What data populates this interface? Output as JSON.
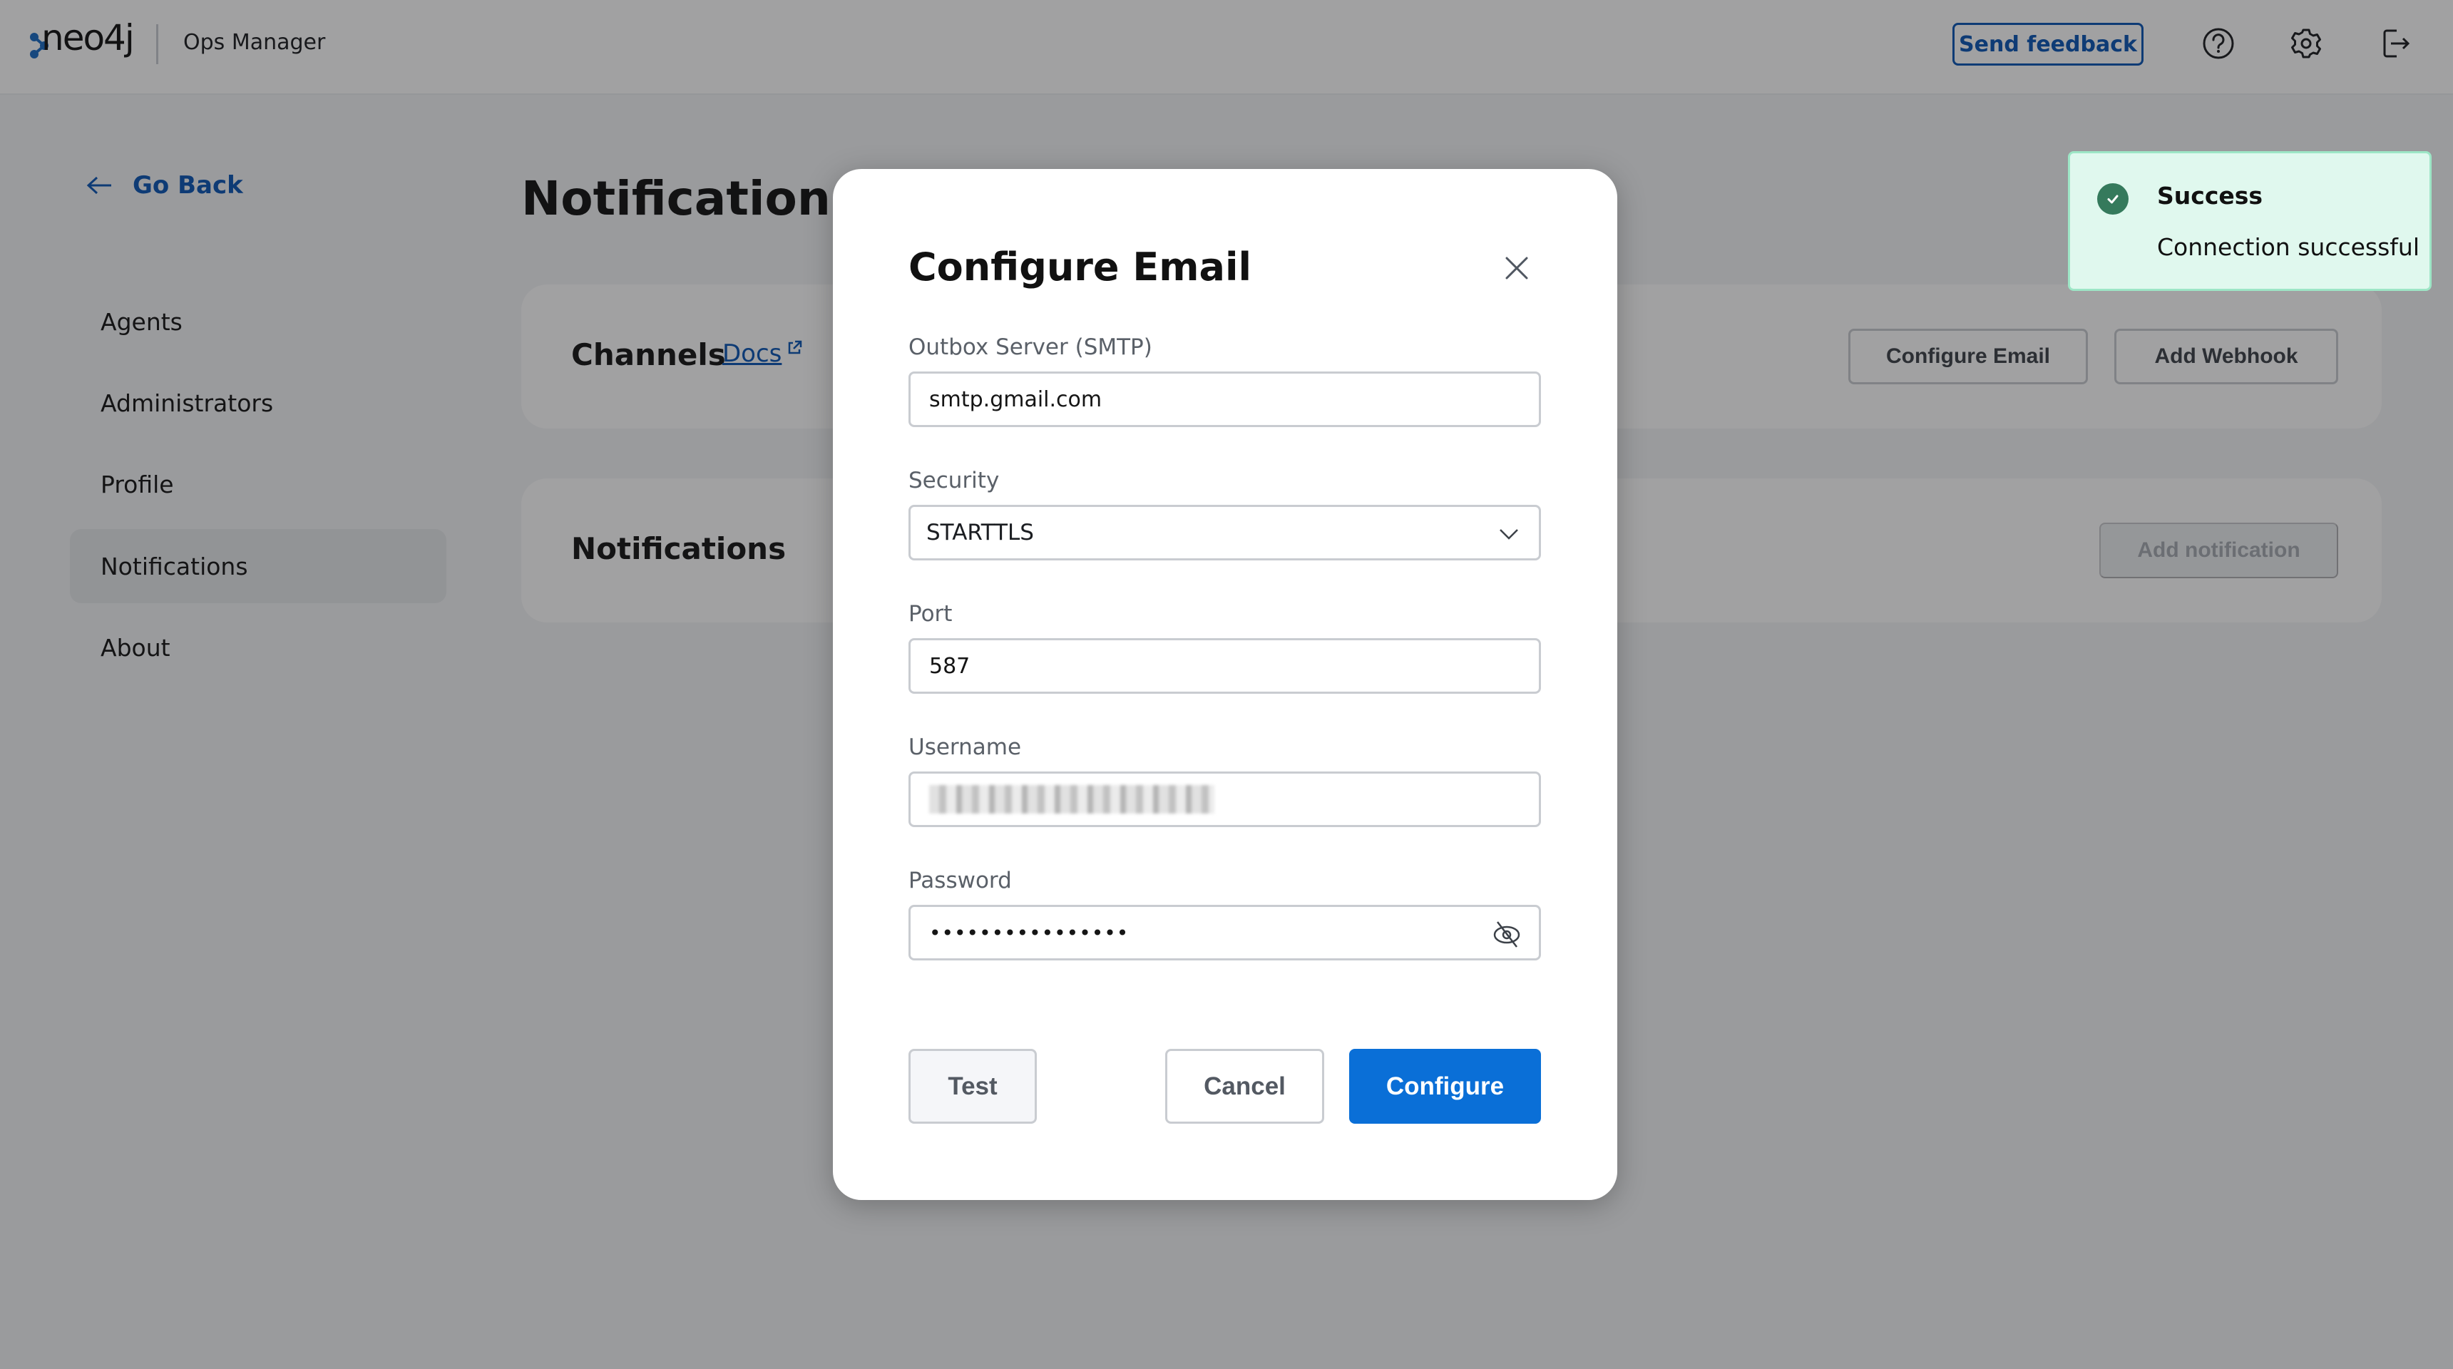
{
  "header": {
    "logo_text": "neo4j",
    "app_name": "Ops Manager",
    "send_feedback_label": "Send feedback",
    "icons": [
      "help-icon",
      "settings-gear-icon",
      "logout-icon"
    ]
  },
  "sidebar": {
    "go_back_label": "Go Back",
    "items": [
      {
        "label": "Agents",
        "active": false
      },
      {
        "label": "Administrators",
        "active": false
      },
      {
        "label": "Profile",
        "active": false
      },
      {
        "label": "Notifications",
        "active": true
      },
      {
        "label": "About",
        "active": false
      }
    ]
  },
  "main": {
    "page_title": "Notifications",
    "channels_card": {
      "title": "Channels",
      "docs_link": "Docs",
      "configure_email_label": "Configure Email",
      "add_webhook_label": "Add Webhook"
    },
    "notifications_card": {
      "title": "Notifications",
      "add_notification_label": "Add notification",
      "add_notification_disabled": true
    }
  },
  "modal": {
    "title": "Configure Email",
    "fields": {
      "smtp": {
        "label": "Outbox Server (SMTP)",
        "value": "smtp.gmail.com"
      },
      "security": {
        "label": "Security",
        "value": "STARTTLS"
      },
      "port": {
        "label": "Port",
        "value": "587"
      },
      "username": {
        "label": "Username",
        "value": "[redacted]"
      },
      "password": {
        "label": "Password",
        "value": "••••••••••••••••"
      }
    },
    "buttons": {
      "test": "Test",
      "cancel": "Cancel",
      "configure": "Configure"
    }
  },
  "toast": {
    "status": "success",
    "title": "Success",
    "message": "Connection successful"
  },
  "colors": {
    "brand_blue": "#0a56b4",
    "primary_button": "#0a6fd7",
    "toast_bg": "#e0f8ee",
    "toast_icon": "#357a5c"
  }
}
